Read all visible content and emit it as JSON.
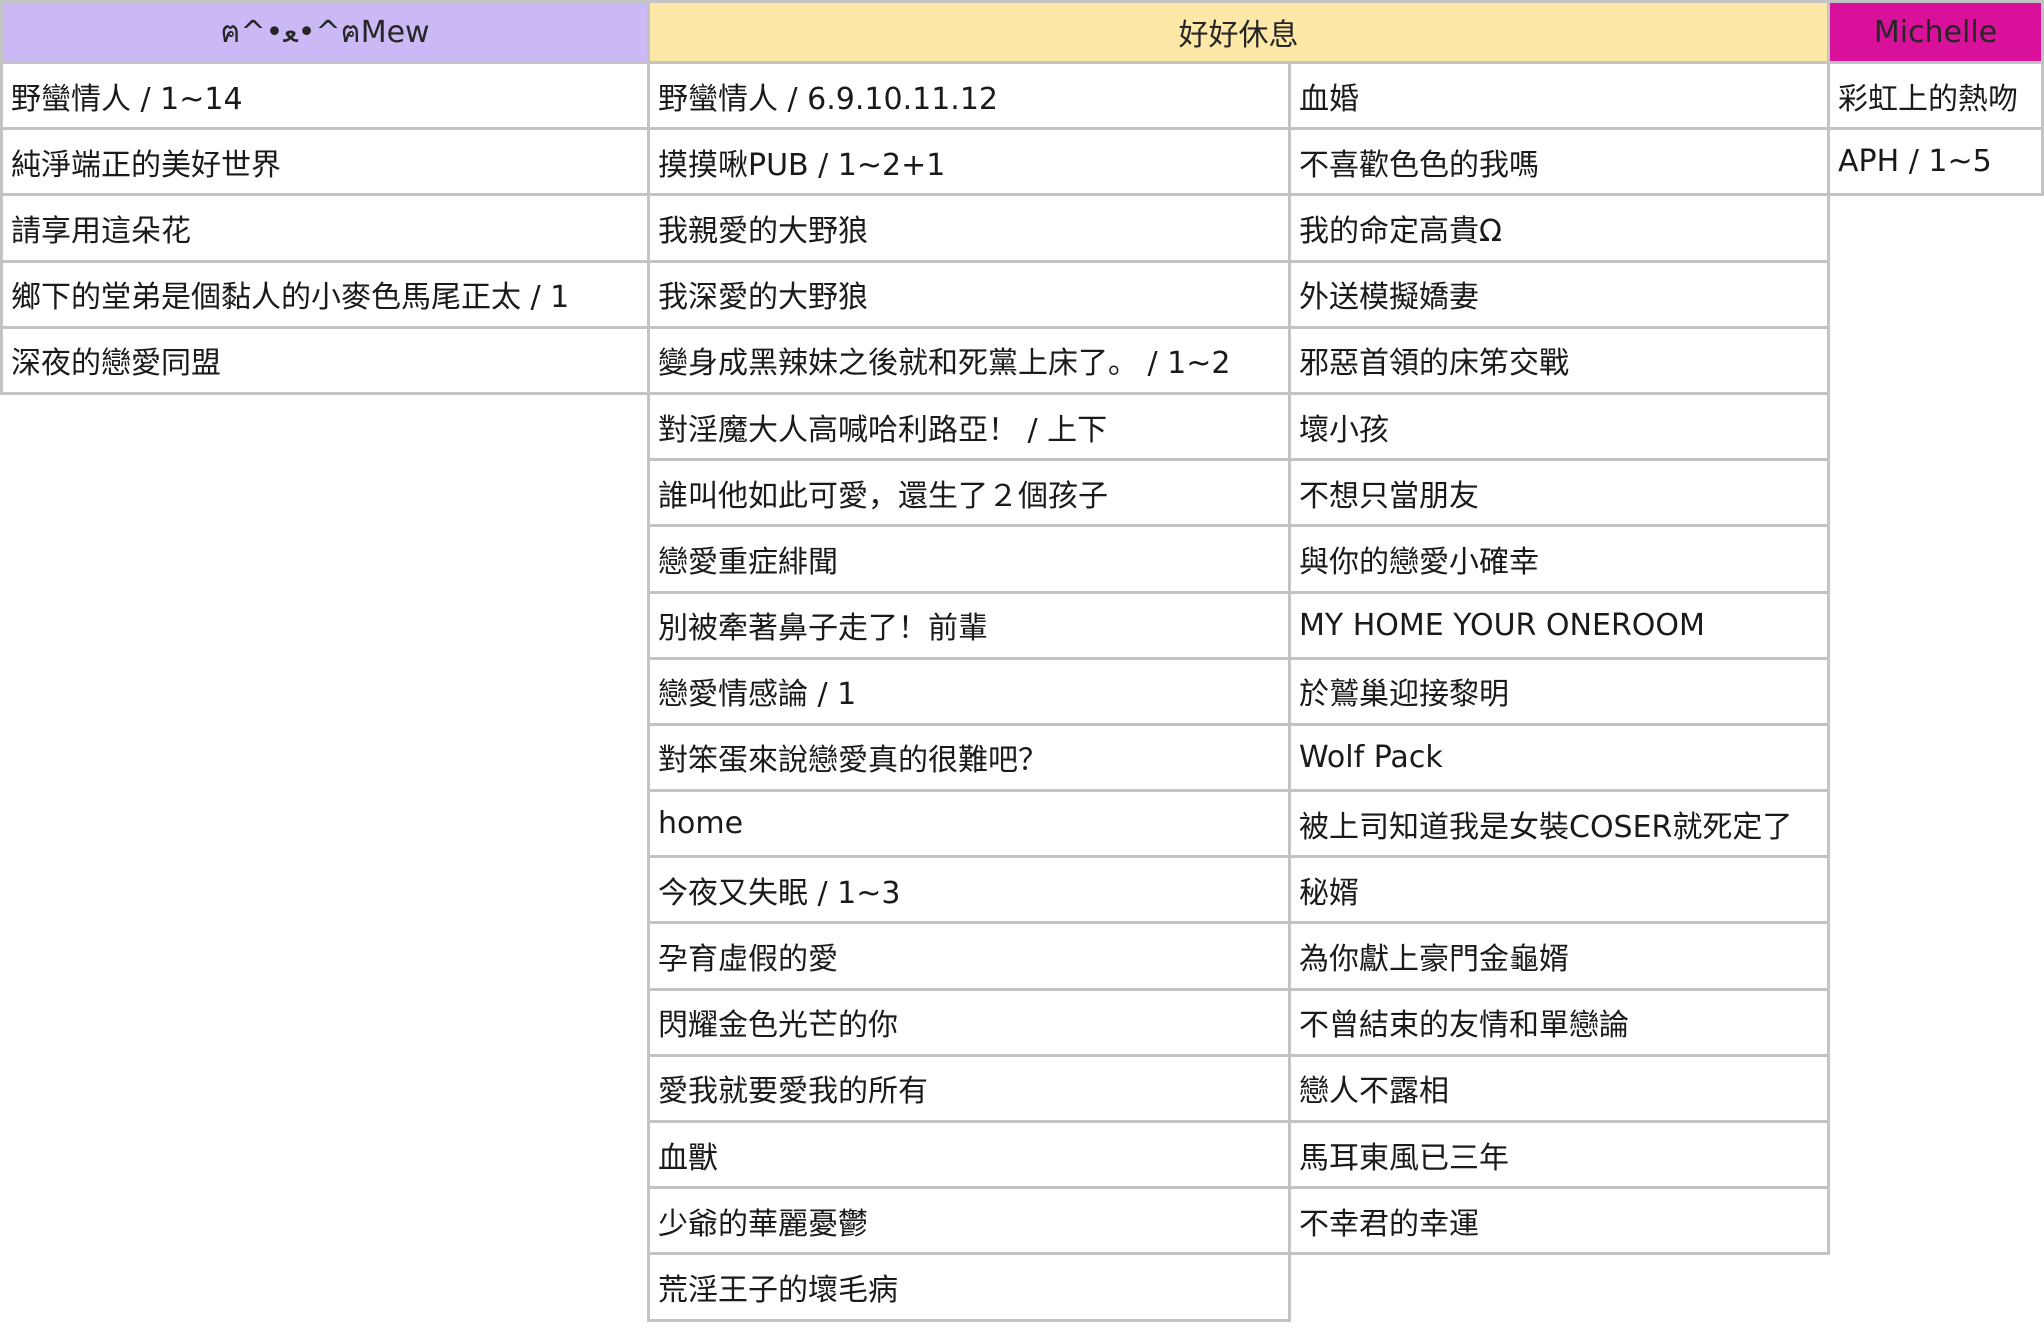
{
  "columns": [
    {
      "header": "ฅ^•ﻌ•^ฅMew",
      "color": "#cbb9f5",
      "items": [
        "野蠻情人 / 1~14",
        "純淨端正的美好世界",
        "請享用這朵花",
        "鄉下的堂弟是個黏人的小麥色馬尾正太 /  1",
        "深夜的戀愛同盟"
      ]
    },
    {
      "header": "好好休息",
      "color": "#fde8a8",
      "left": [
        "野蠻情人 / 6.9.10.11.12",
        "摸摸啾PUB / 1~2+1",
        "我親愛的大野狼",
        "我深愛的大野狼",
        "變身成黑辣妹之後就和死黨上床了。 / 1~2",
        "對淫魔大人高喊哈利路亞！ / 上下",
        "誰叫他如此可愛，還生了２個孩子",
        "戀愛重症緋聞",
        "別被牽著鼻子走了！前輩",
        "戀愛情感論 / 1",
        "對笨蛋來說戀愛真的很難吧？",
        "home",
        "今夜又失眠 / 1~3",
        "孕育虛假的愛",
        "閃耀金色光芒的你",
        "愛我就要愛我的所有",
        "血獸",
        "少爺的華麗憂鬱",
        "荒淫王子的壞毛病"
      ],
      "right": [
        "血婚",
        "不喜歡色色的我嗎",
        "我的命定高貴Ω",
        "外送模擬嬌妻",
        "邪惡首領的床笫交戰",
        "壞小孩",
        "不想只當朋友",
        "與你的戀愛小確幸",
        "MY HOME YOUR ONEROOM",
        "於鷲巢迎接黎明",
        "Wolf Pack",
        "被上司知道我是女裝COSER就死定了",
        "秘婿",
        "為你獻上豪門金龜婿",
        "不曾結束的友情和單戀論",
        "戀人不露相",
        "馬耳東風已三年",
        "不幸君的幸運"
      ]
    },
    {
      "header": "Michelle",
      "color": "#d9119a",
      "items": [
        "彩虹上的熱吻",
        "APH / 1~5"
      ]
    }
  ]
}
